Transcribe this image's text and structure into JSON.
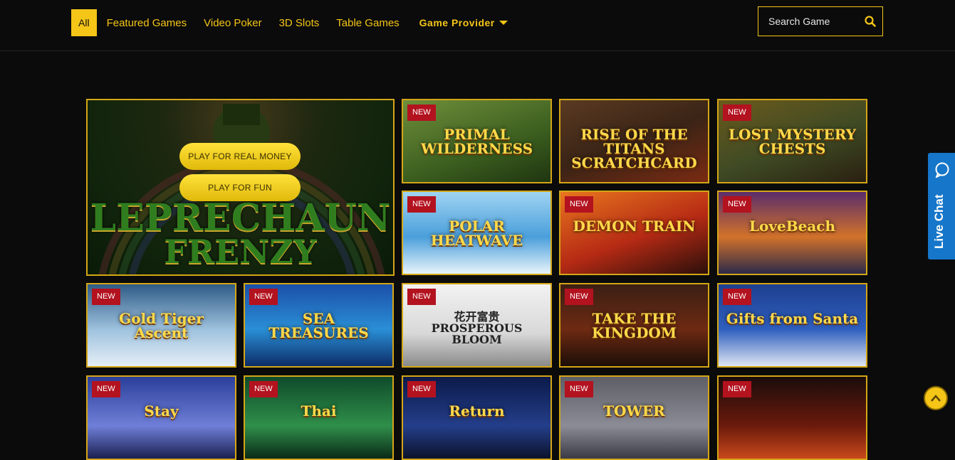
{
  "nav": {
    "items": [
      {
        "label": "All",
        "active": true
      },
      {
        "label": "Featured Games"
      },
      {
        "label": "Video Poker"
      },
      {
        "label": "3D Slots"
      },
      {
        "label": "Table Games"
      }
    ],
    "provider_label": "Game Provider"
  },
  "search": {
    "placeholder": "Search Game"
  },
  "featured": {
    "title_line1": "LEPRECHAUN",
    "title_line2": "FRENZY",
    "play_real_label": "PLAY FOR REAL MONEY",
    "play_fun_label": "PLAY FOR FUN"
  },
  "badge_label": "NEW",
  "games": [
    {
      "title": "PRIMAL WILDERNESS",
      "new": true
    },
    {
      "title": "RISE OF THE TITANS SCRATCHCARD",
      "new": false
    },
    {
      "title": "LOST MYSTERY CHESTS",
      "new": true
    },
    {
      "title": "POLAR HEATWAVE",
      "new": true
    },
    {
      "title": "DEMON TRAIN",
      "new": true
    },
    {
      "title": "LoveBeach",
      "new": true
    },
    {
      "title": "Gold Tiger Ascent",
      "new": true
    },
    {
      "title": "SEA TREASURES",
      "new": true
    },
    {
      "title": "花开富贵 PROSPEROUS BLOOM",
      "new": true
    },
    {
      "title": "TAKE THE KINGDOM",
      "new": true
    },
    {
      "title": "Gifts from Santa",
      "new": true
    },
    {
      "title": "Stay",
      "new": true
    },
    {
      "title": "Thai",
      "new": true
    },
    {
      "title": "Return",
      "new": true
    },
    {
      "title": "TOWER",
      "new": true
    },
    {
      "title": "",
      "new": true
    }
  ],
  "chat": {
    "label": "Live Chat"
  },
  "colors": {
    "accent": "#f5c518",
    "badge": "#b3121f",
    "chat": "#1676c9",
    "background": "#0b0b0b"
  }
}
